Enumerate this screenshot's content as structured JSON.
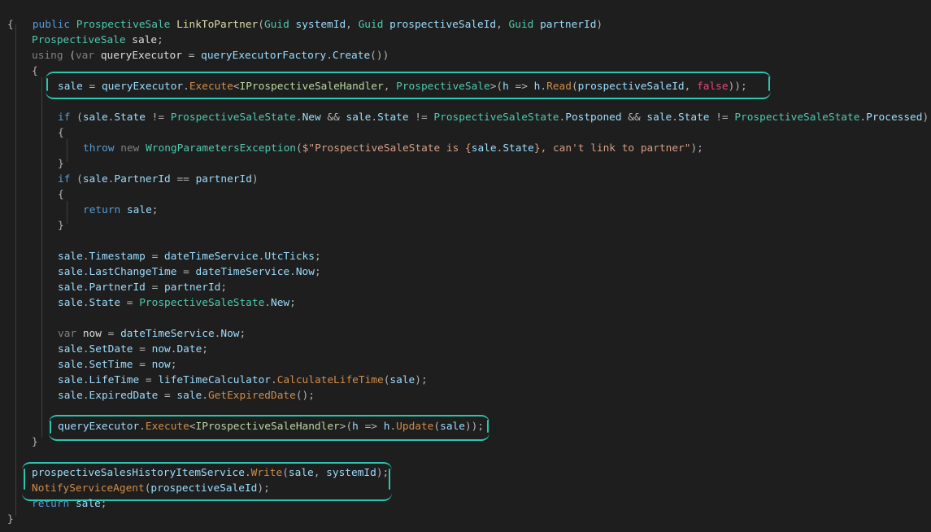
{
  "editor": {
    "language": "C#",
    "lines": [
      "public ProspectiveSale LinkToPartner(Guid systemId, Guid prospectiveSaleId, Guid partnerId)",
      "{",
      "    ProspectiveSale sale;",
      "    using (var queryExecutor = queryExecutorFactory.Create())",
      "    {",
      "        sale = queryExecutor.Execute<IProspectiveSaleHandler, ProspectiveSale>(h => h.Read(prospectiveSaleId, false));",
      "",
      "        if (sale.State != ProspectiveSaleState.New && sale.State != ProspectiveSaleState.Postponed && sale.State != ProspectiveSaleState.Processed)",
      "        {",
      "            throw new WrongParametersException($\"ProspectiveSaleState is {sale.State}, can't link to partner\");",
      "        }",
      "        if (sale.PartnerId == partnerId)",
      "        {",
      "            return sale;",
      "        }",
      "",
      "        sale.Timestamp = dateTimeService.UtcTicks;",
      "        sale.LastChangeTime = dateTimeService.Now;",
      "        sale.PartnerId = partnerId;",
      "        sale.State = ProspectiveSaleState.New;",
      "",
      "        var now = dateTimeService.Now;",
      "        sale.SetDate = now.Date;",
      "        sale.SetTime = now;",
      "        sale.LifeTime = lifeTimeCalculator.CalculateLifeTime(sale);",
      "        sale.ExpiredDate = sale.GetExpiredDate();",
      "",
      "        queryExecutor.Execute<IProspectiveSaleHandler>(h => h.Update(sale));",
      "    }",
      "",
      "    prospectiveSalesHistoryItemService.Write(sale, systemId);",
      "    NotifyServiceAgent(prospectiveSaleId);",
      "    return sale;",
      "}"
    ]
  },
  "tokens": {
    "l0": [
      "public",
      "ProspectiveSale",
      "LinkToPartner",
      "(",
      "Guid",
      "systemId",
      ", ",
      "Guid",
      "prospectiveSaleId",
      ", ",
      "Guid",
      "partnerId",
      ")"
    ],
    "l1": [
      "{"
    ],
    "l2": [
      "ProspectiveSale",
      "sale",
      ";"
    ],
    "l3": [
      "using",
      "(",
      "var",
      "queryExecutor",
      " = ",
      "queryExecutorFactory",
      ".",
      "Create",
      "())"
    ],
    "l4": [
      "{"
    ],
    "l5": [
      "sale",
      " = ",
      "queryExecutor",
      ".",
      "Execute",
      "<",
      "IProspectiveSaleHandler",
      ", ",
      "ProspectiveSale",
      ">(",
      "h",
      " => ",
      "h",
      ".",
      "Read",
      "(",
      "prospectiveSaleId",
      ", ",
      "false",
      "));"
    ],
    "l7": [
      "if",
      " (",
      "sale",
      ".",
      "State",
      " != ",
      "ProspectiveSaleState",
      ".",
      "New",
      " && ",
      "sale",
      ".",
      "State",
      " != ",
      "ProspectiveSaleState",
      ".",
      "Postponed",
      " && ",
      "sale",
      ".",
      "State",
      " != ",
      "ProspectiveSaleState",
      ".",
      "Processed",
      ")"
    ],
    "l8": [
      "{"
    ],
    "l9": [
      "throw",
      "new",
      "WrongParametersException",
      "(",
      "$\"ProspectiveSaleState is ",
      "{",
      "sale",
      ".",
      "State",
      "}",
      ", can't link to partner\"",
      ");"
    ],
    "l10": [
      "}"
    ],
    "l11": [
      "if",
      " (",
      "sale",
      ".",
      "PartnerId",
      " == ",
      "partnerId",
      ")"
    ],
    "l12": [
      "{"
    ],
    "l13": [
      "return",
      "sale",
      ";"
    ],
    "l14": [
      "}"
    ],
    "l16": [
      "sale",
      ".",
      "Timestamp",
      " = ",
      "dateTimeService",
      ".",
      "UtcTicks",
      ";"
    ],
    "l17": [
      "sale",
      ".",
      "LastChangeTime",
      " = ",
      "dateTimeService",
      ".",
      "Now",
      ";"
    ],
    "l18": [
      "sale",
      ".",
      "PartnerId",
      " = ",
      "partnerId",
      ";"
    ],
    "l19": [
      "sale",
      ".",
      "State",
      " = ",
      "ProspectiveSaleState",
      ".",
      "New",
      ";"
    ],
    "l21": [
      "var",
      "now",
      " = ",
      "dateTimeService",
      ".",
      "Now",
      ";"
    ],
    "l22": [
      "sale",
      ".",
      "SetDate",
      " = ",
      "now",
      ".",
      "Date",
      ";"
    ],
    "l23": [
      "sale",
      ".",
      "SetTime",
      " = ",
      "now",
      ";"
    ],
    "l24": [
      "sale",
      ".",
      "LifeTime",
      " = ",
      "lifeTimeCalculator",
      ".",
      "CalculateLifeTime",
      "(",
      "sale",
      ");"
    ],
    "l25": [
      "sale",
      ".",
      "ExpiredDate",
      " = ",
      "sale",
      ".",
      "GetExpiredDate",
      "();"
    ],
    "l27": [
      "queryExecutor",
      ".",
      "Execute",
      "<",
      "IProspectiveSaleHandler",
      ">(",
      "h",
      " => ",
      "h",
      ".",
      "Update",
      "(",
      "sale",
      "));"
    ],
    "l28": [
      "}"
    ],
    "l30": [
      "prospectiveSalesHistoryItemService",
      ".",
      "Write",
      "(",
      "sale",
      ", ",
      "systemId",
      ");"
    ],
    "l31": [
      "NotifyServiceAgent",
      "(",
      "prospectiveSaleId",
      ");"
    ],
    "l32": [
      "return",
      "sale",
      ";"
    ],
    "l33": [
      "}"
    ]
  },
  "colors": {
    "background": "#1e1e1e",
    "highlight": "#2bc6b0",
    "keyword": "#569cd6",
    "type": "#4ec9b0",
    "method": "#d08c4a",
    "parameter": "#9cdcfe",
    "string": "#d69d85",
    "boolean_false": "#e14b7a"
  },
  "annotations": [
    {
      "name": "execute-read-highlight"
    },
    {
      "name": "execute-update-highlight"
    },
    {
      "name": "history-notify-highlight"
    }
  ]
}
